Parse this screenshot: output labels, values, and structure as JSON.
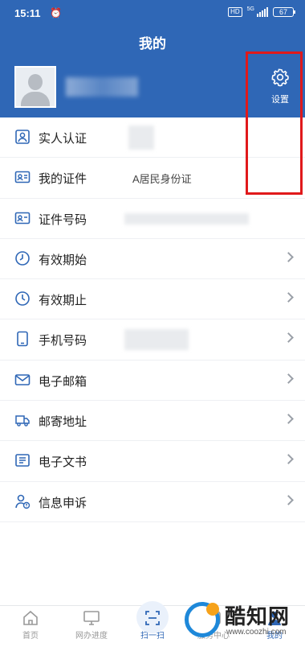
{
  "status_bar": {
    "time": "15:11",
    "hd": "HD",
    "network": "5G",
    "battery": "67"
  },
  "header": {
    "title": "我的",
    "settings_label": "设置"
  },
  "profile": {
    "avatar": "avatar-placeholder"
  },
  "menu": [
    {
      "label": "实人认证",
      "value": "",
      "icon": "person-card-icon",
      "chevron": false
    },
    {
      "label": "我的证件",
      "value": "A居民身份证",
      "icon": "id-card-icon",
      "chevron": false
    },
    {
      "label": "证件号码",
      "value": "",
      "icon": "id-number-icon",
      "chevron": false
    },
    {
      "label": "有效期始",
      "value": "",
      "icon": "clock-icon",
      "chevron": true
    },
    {
      "label": "有效期止",
      "value": "",
      "icon": "clock-icon",
      "chevron": true
    },
    {
      "label": "手机号码",
      "value": "",
      "icon": "phone-icon",
      "chevron": true
    },
    {
      "label": "电子邮箱",
      "value": "",
      "icon": "mail-icon",
      "chevron": true
    },
    {
      "label": "邮寄地址",
      "value": "",
      "icon": "truck-icon",
      "chevron": true
    },
    {
      "label": "电子文书",
      "value": "",
      "icon": "document-icon",
      "chevron": true
    },
    {
      "label": "信息申诉",
      "value": "",
      "icon": "appeal-icon",
      "chevron": true
    }
  ],
  "tabs": [
    {
      "label": "首页",
      "icon": "home-icon"
    },
    {
      "label": "网办进度",
      "icon": "monitor-icon"
    },
    {
      "label": "扫一扫",
      "icon": "scan-icon"
    },
    {
      "label": "服务中心",
      "icon": "service-icon"
    },
    {
      "label": "我的",
      "icon": "user-icon"
    }
  ],
  "watermark": {
    "title": "酷知网",
    "url": "www.coozhi.com"
  },
  "colors": {
    "header_blue": "#2f67b6",
    "highlight_red": "#e0191b"
  }
}
